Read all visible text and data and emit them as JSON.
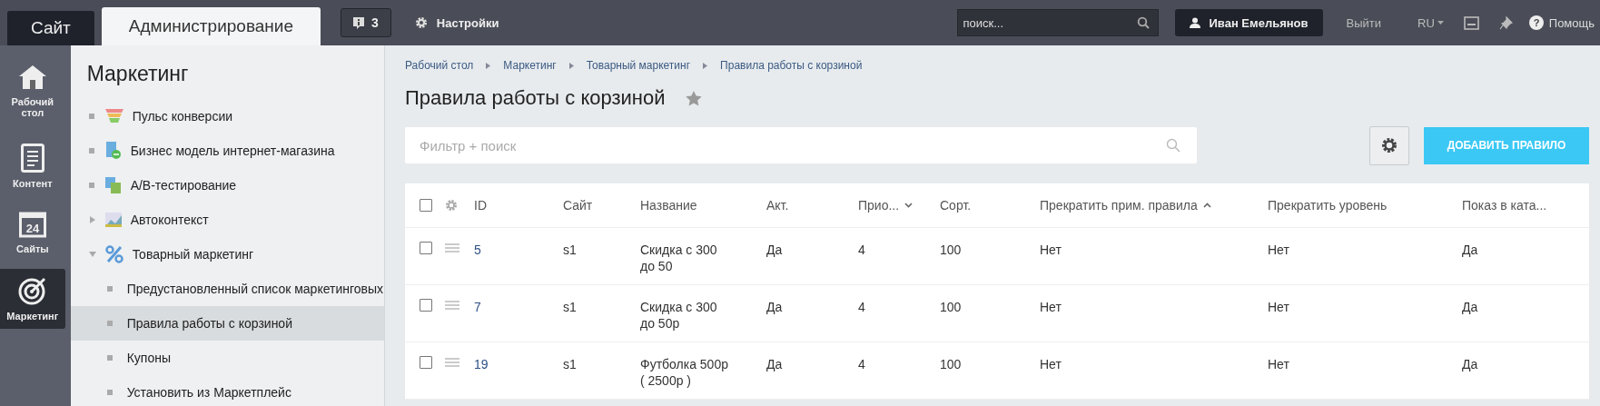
{
  "top_tabs": [
    {
      "label": "Сайт",
      "selected": false
    },
    {
      "label": "Администрирование",
      "selected": true
    }
  ],
  "notifications": {
    "count": "3"
  },
  "settings_link": "Настройки",
  "search": {
    "placeholder": "поиск..."
  },
  "user": "Иван Емельянов",
  "logout": "Выйти",
  "language": "RU",
  "help": "Помощь",
  "help_icon_glyph": "?",
  "calendar_day": "24",
  "left_nav": [
    {
      "label": "Рабочий стол",
      "selected": false
    },
    {
      "label": "Контент",
      "selected": false
    },
    {
      "label": "Сайты",
      "selected": false
    },
    {
      "label": "Маркетинг",
      "selected": true
    }
  ],
  "sidebar": {
    "title": "Маркетинг",
    "items": [
      {
        "label": "Пульс конверсии",
        "selected": false
      },
      {
        "label": "Бизнес модель интернет-магазина",
        "selected": false
      },
      {
        "label": "A/B-тестирование",
        "selected": false
      },
      {
        "label": "Автоконтекст",
        "selected": false,
        "expanded": false
      },
      {
        "label": "Товарный маркетинг",
        "selected": false,
        "expanded": true,
        "children": [
          {
            "label": "Предустановленный список маркетинговых",
            "selected": false
          },
          {
            "label": "Правила работы с корзиной",
            "selected": true
          },
          {
            "label": "Купоны",
            "selected": false
          },
          {
            "label": "Установить из Маркетплейс",
            "selected": false
          }
        ]
      }
    ]
  },
  "breadcrumbs": [
    "Рабочий стол",
    "Маркетинг",
    "Товарный маркетинг",
    "Правила работы с корзиной"
  ],
  "page_title": "Правила работы с корзиной",
  "filter": {
    "placeholder": "Фильтр + поиск"
  },
  "add_button": "ДОБАВИТЬ ПРАВИЛО",
  "table": {
    "select_all_checked": false,
    "columns": [
      {
        "label": "ID"
      },
      {
        "label": "Сайт"
      },
      {
        "label": "Название"
      },
      {
        "label": "Акт."
      },
      {
        "label": "Прио...",
        "sort_ascending": false
      },
      {
        "label": "Сорт."
      },
      {
        "label": "Прекратить прим. правила",
        "sort_ascending": true
      },
      {
        "label": "Прекратить уровень"
      },
      {
        "label": "Показ в ката..."
      }
    ],
    "rows": [
      {
        "checked": false,
        "cells": [
          "5",
          "s1",
          "Скидка с 300 до 50",
          "Да",
          "4",
          "100",
          "Нет",
          "Нет",
          "Да"
        ]
      },
      {
        "checked": false,
        "cells": [
          "7",
          "s1",
          "Скидка с 300 до 50р",
          "Да",
          "4",
          "100",
          "Нет",
          "Нет",
          "Да"
        ]
      },
      {
        "checked": false,
        "cells": [
          "19",
          "s1",
          "Футболка 500р ( 2500р )",
          "Да",
          "4",
          "100",
          "Нет",
          "Нет",
          "Да"
        ]
      }
    ]
  }
}
